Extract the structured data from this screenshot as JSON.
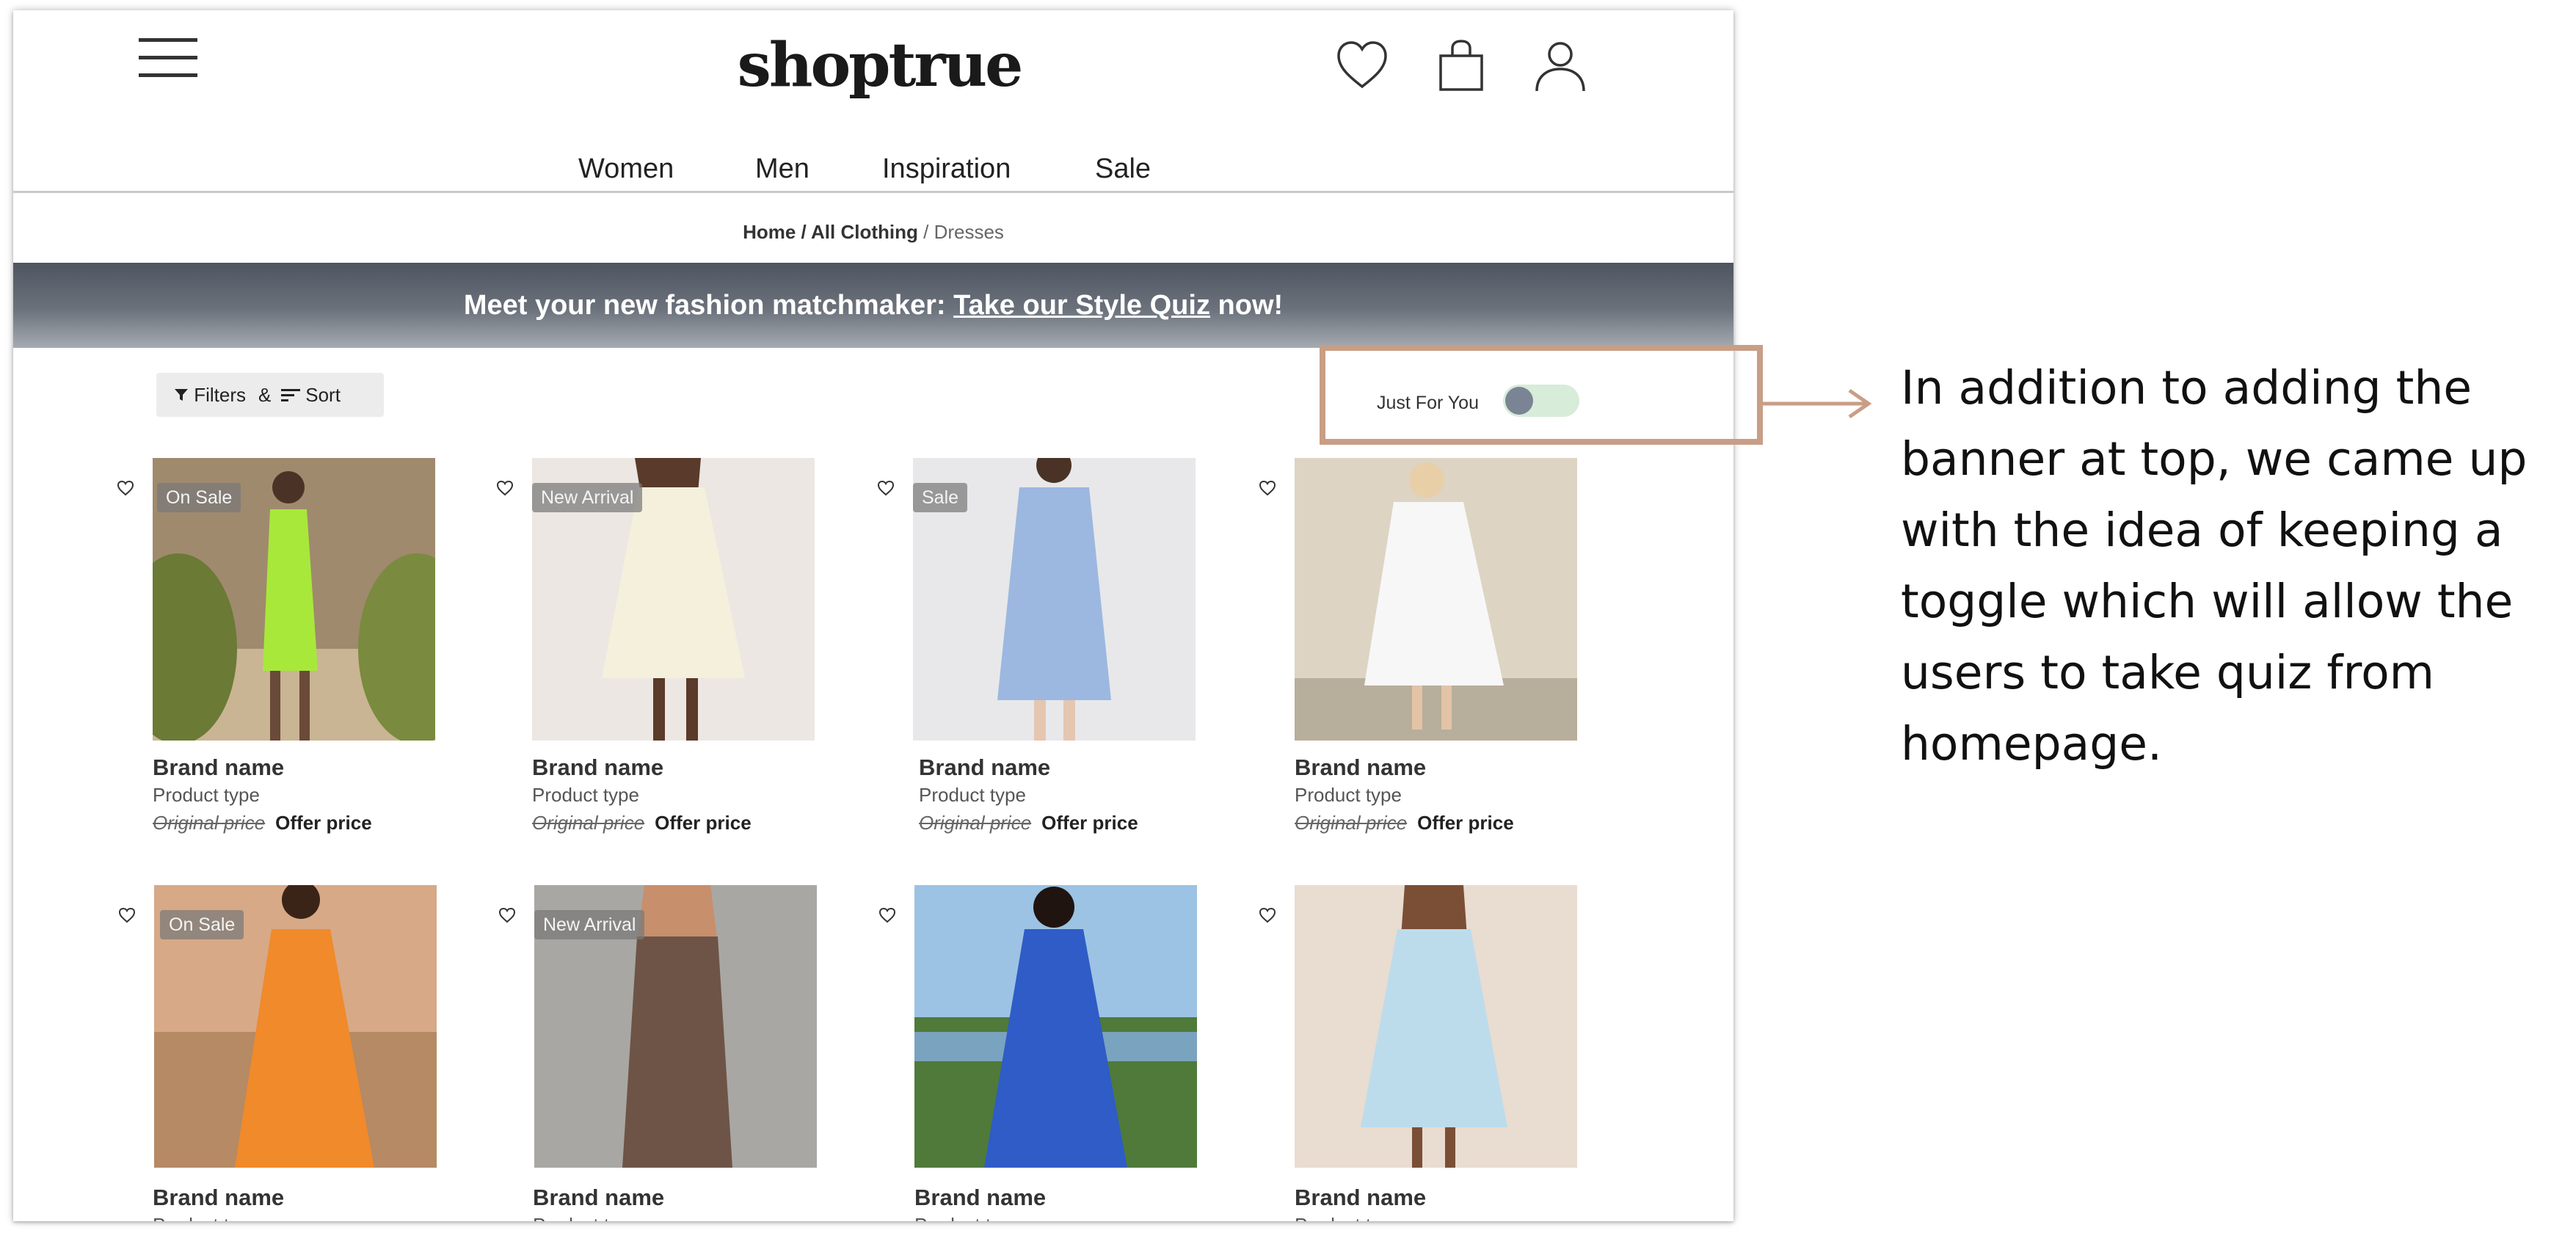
{
  "header": {
    "logo": "shoptrue",
    "icons": [
      "menu-icon",
      "heart-icon",
      "shopping-bag-icon",
      "user-icon"
    ]
  },
  "nav": {
    "items": [
      "Women",
      "Men",
      "Inspiration",
      "Sale"
    ]
  },
  "breadcrumb": {
    "home": "Home",
    "sep1": " / ",
    "all_clothing": "All Clothing",
    "sep2": " / ",
    "current": "Dresses"
  },
  "banner": {
    "text_before": "Meet your new fashion matchmaker: ",
    "link": "Take our Style Quiz",
    "text_after": " now!"
  },
  "controls": {
    "filters_label": "Filters",
    "amp": "&",
    "sort_label": "Sort",
    "toggle_label": "Just For You",
    "toggle_on": false
  },
  "products": [
    {
      "badge": "On Sale",
      "brand": "Brand name",
      "type": "Product type",
      "original_price": "Original price",
      "offer_price": "Offer price"
    },
    {
      "badge": "New Arrival",
      "brand": "Brand name",
      "type": "Product type",
      "original_price": "Original price",
      "offer_price": "Offer price"
    },
    {
      "badge": "Sale",
      "brand": "Brand name",
      "type": "Product type",
      "original_price": "Original price",
      "offer_price": "Offer price"
    },
    {
      "badge": "",
      "brand": "Brand name",
      "type": "Product type",
      "original_price": "Original price",
      "offer_price": "Offer price"
    },
    {
      "badge": "On Sale",
      "brand": "Brand name",
      "type": "Product type",
      "original_price": "",
      "offer_price": ""
    },
    {
      "badge": "New Arrival",
      "brand": "Brand name",
      "type": "Product type",
      "original_price": "",
      "offer_price": ""
    },
    {
      "badge": "",
      "brand": "Brand name",
      "type": "Product type",
      "original_price": "",
      "offer_price": ""
    },
    {
      "badge": "",
      "brand": "Brand name",
      "type": "Product type",
      "original_price": "",
      "offer_price": ""
    }
  ],
  "annotation": {
    "text": "In addition to adding the banner at top, we came up with the idea of keeping a toggle which will allow the users to take quiz from homepage.",
    "color": "#c89e86"
  },
  "colors": {
    "banner": "#5a606a",
    "toggle_track": "#d7ecd9",
    "toggle_knob": "#7b8494"
  }
}
